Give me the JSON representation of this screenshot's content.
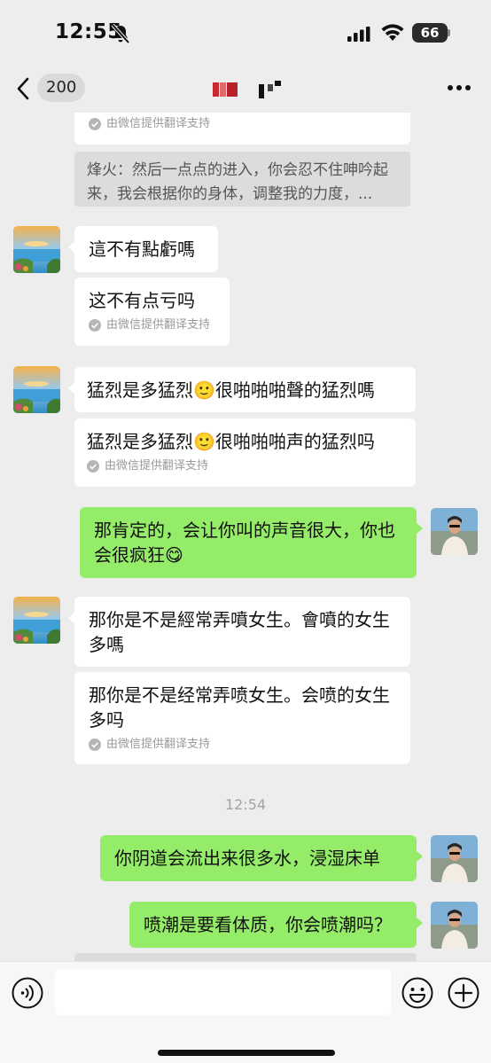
{
  "status_bar": {
    "time": "12:55",
    "battery": "66"
  },
  "nav": {
    "unread_count": "200",
    "brand_color": "#c8282f"
  },
  "chat": {
    "translation_note": "由微信提供翻译支持",
    "messages": [
      {
        "quote": "烽火：然后一点点的进入，你会忍不住呻吟起来，我会根据你的身体，调整我的力度，..."
      },
      {
        "original": "這不有點虧嗎",
        "translated": "这不有点亏吗"
      },
      {
        "original": "猛烈是多猛烈🙂很啪啪啪聲的猛烈嗎",
        "translated": "猛烈是多猛烈🙂很啪啪啪声的猛烈吗"
      },
      {
        "text": "那肯定的，会让你叫的声音很大，你也会很疯狂😋"
      },
      {
        "original": "那你是不是經常弄噴女生。會噴的女生多嗎",
        "translated": "那你是不是经常弄喷女生。会喷的女生多吗"
      },
      {
        "text": "你阴道会流出来很多水，浸湿床单"
      },
      {
        "text": "喷潮是要看体质，你会喷潮吗？"
      }
    ],
    "timestamp": "12:54"
  },
  "input": {
    "placeholder": ""
  },
  "colors": {
    "sent_bubble": "#95ec69",
    "received_bubble": "#ffffff",
    "background": "#ededed"
  }
}
